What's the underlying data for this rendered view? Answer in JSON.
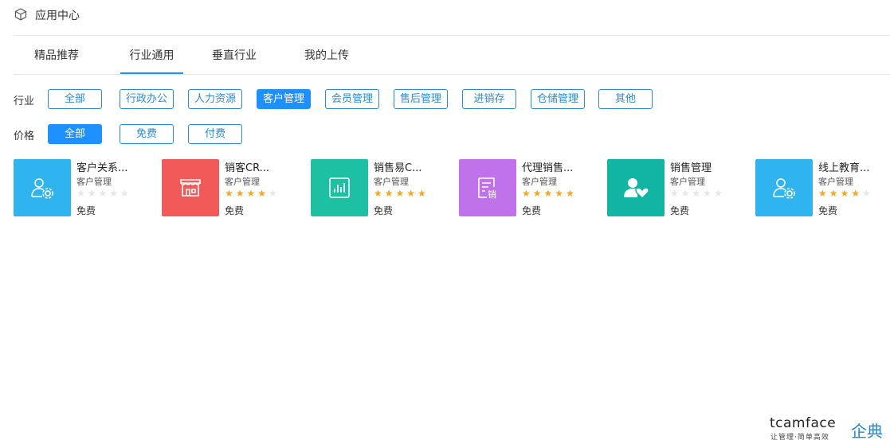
{
  "header": {
    "title": "应用中心",
    "icon": "cube-icon"
  },
  "tabs": [
    {
      "label": "精品推荐",
      "active": false
    },
    {
      "label": "行业通用",
      "active": true
    },
    {
      "label": "垂直行业",
      "active": false
    },
    {
      "label": "我的上传",
      "active": false
    }
  ],
  "filters": {
    "industry": {
      "label": "行业",
      "options": [
        "全部",
        "行政办公",
        "人力资源",
        "客户管理",
        "会员管理",
        "售后管理",
        "进销存",
        "仓储管理",
        "其他"
      ],
      "selected": "客户管理"
    },
    "price": {
      "label": "价格",
      "options": [
        "全部",
        "免费",
        "付费"
      ],
      "selected": "全部"
    }
  },
  "apps": [
    {
      "name": "客户关系...",
      "category": "客户管理",
      "rating": 0,
      "price": "免费",
      "color": "#30b4f0",
      "icon": "user-gear-icon"
    },
    {
      "name": "销客CR...",
      "category": "客户管理",
      "rating": 4,
      "price": "免费",
      "color": "#f25a5a",
      "icon": "storefront-icon"
    },
    {
      "name": "销售易C...",
      "category": "客户管理",
      "rating": 5,
      "price": "免费",
      "color": "#1ec0a4",
      "icon": "bar-chart-icon"
    },
    {
      "name": "代理销售...",
      "category": "客户管理",
      "rating": 5,
      "price": "免费",
      "color": "#bf72ea",
      "icon": "sales-document-icon"
    },
    {
      "name": "销售管理",
      "category": "客户管理",
      "rating": 0,
      "price": "免费",
      "color": "#12b4a4",
      "icon": "user-heart-icon"
    },
    {
      "name": "线上教育...",
      "category": "客户管理",
      "rating": 4,
      "price": "免费",
      "color": "#30b4f0",
      "icon": "user-gear-icon"
    }
  ],
  "brand": {
    "wordmark": "tcamface",
    "chinese": "企典",
    "slogan": "让管理·简单高效"
  }
}
